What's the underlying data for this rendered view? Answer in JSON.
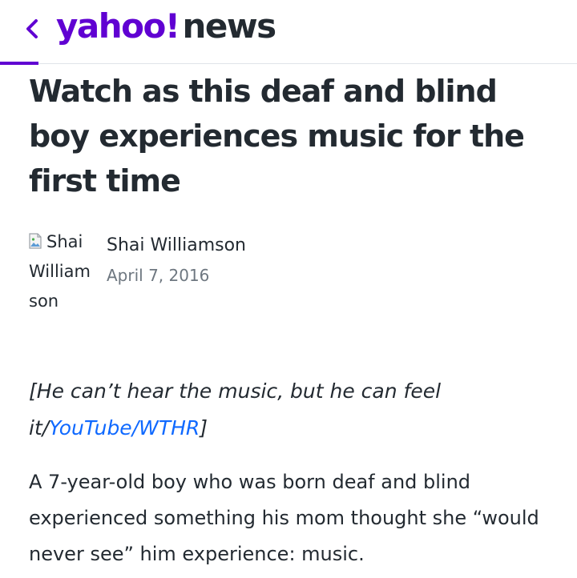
{
  "header": {
    "brand": "yahoo!",
    "section": "news",
    "brand_color": "#6001d2",
    "back_icon": "chevron-left-icon"
  },
  "article": {
    "title": "Watch as this deaf and blind boy experiences music for the first time",
    "author": {
      "name": "Shai Williamson",
      "avatar_alt": "Shai Williamson"
    },
    "date": "April 7, 2016",
    "caption": {
      "open": "[",
      "text": "He can’t hear the music, but he can feel it/",
      "link": "YouTube/WTHR",
      "close": "]",
      "link_color": "#0f69ff"
    },
    "paragraph": "A 7-year-old boy who was born deaf and blind experienced something his mom thought she “would never see” him experience: music."
  }
}
